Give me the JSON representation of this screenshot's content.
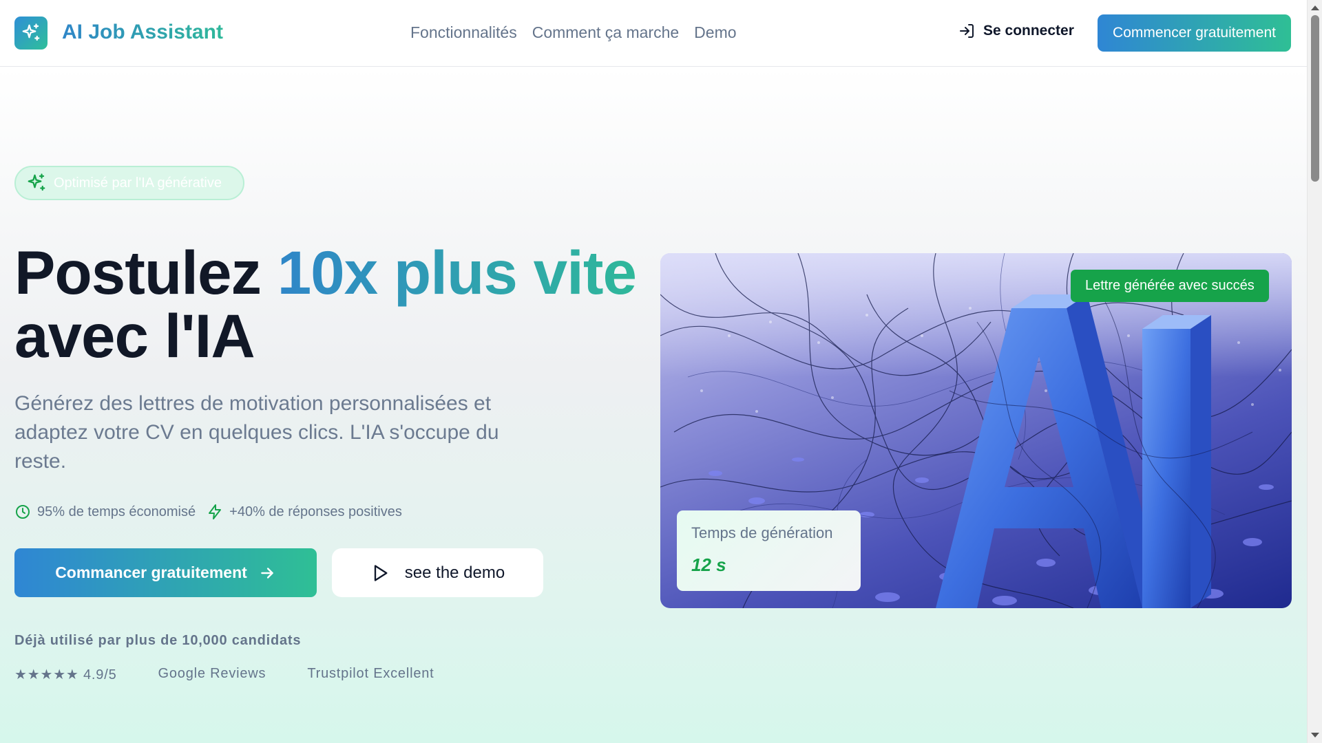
{
  "header": {
    "logo_text": "AI Job Assistant",
    "nav": [
      "Fonctionnalités",
      "Comment ça marche",
      "Demo"
    ],
    "login_label": "Se connecter",
    "cta_label": "Commencer gratuitement"
  },
  "hero": {
    "badge": "Optimisé par l'IA générative",
    "title_part1": "Postulez ",
    "title_accent": "10x plus vite",
    "title_part2": "avec l'IA",
    "subtitle": "Générez des lettres de motivation personnalisées et adaptez votre CV en quelques clics. L'IA s'occupe du reste.",
    "stats": [
      {
        "icon": "clock-icon",
        "text": "95% de temps économisé"
      },
      {
        "icon": "bolt-icon",
        "text": "+40% de réponses positives"
      }
    ],
    "primary_button": "Commancer gratuitement",
    "demo_button": "see the demo",
    "trust_title": "Déjà utilisé par plus de 10,000 candidats",
    "trust_items": [
      "★★★★★ 4.9/5",
      "Google Reviews",
      "Trustpilot Excellent"
    ]
  },
  "image_card": {
    "image_icon": "ai-3d-letters",
    "image_letters": "AI",
    "success_badge": "Lettre générée avec succés",
    "gen_label": "Temps de génération",
    "gen_value": "12 s"
  },
  "colors": {
    "brand_blue": "#2f86d4",
    "brand_green": "#2fbf95",
    "success_green": "#16a34a",
    "text_dark": "#111827",
    "text_muted": "#64748b"
  }
}
